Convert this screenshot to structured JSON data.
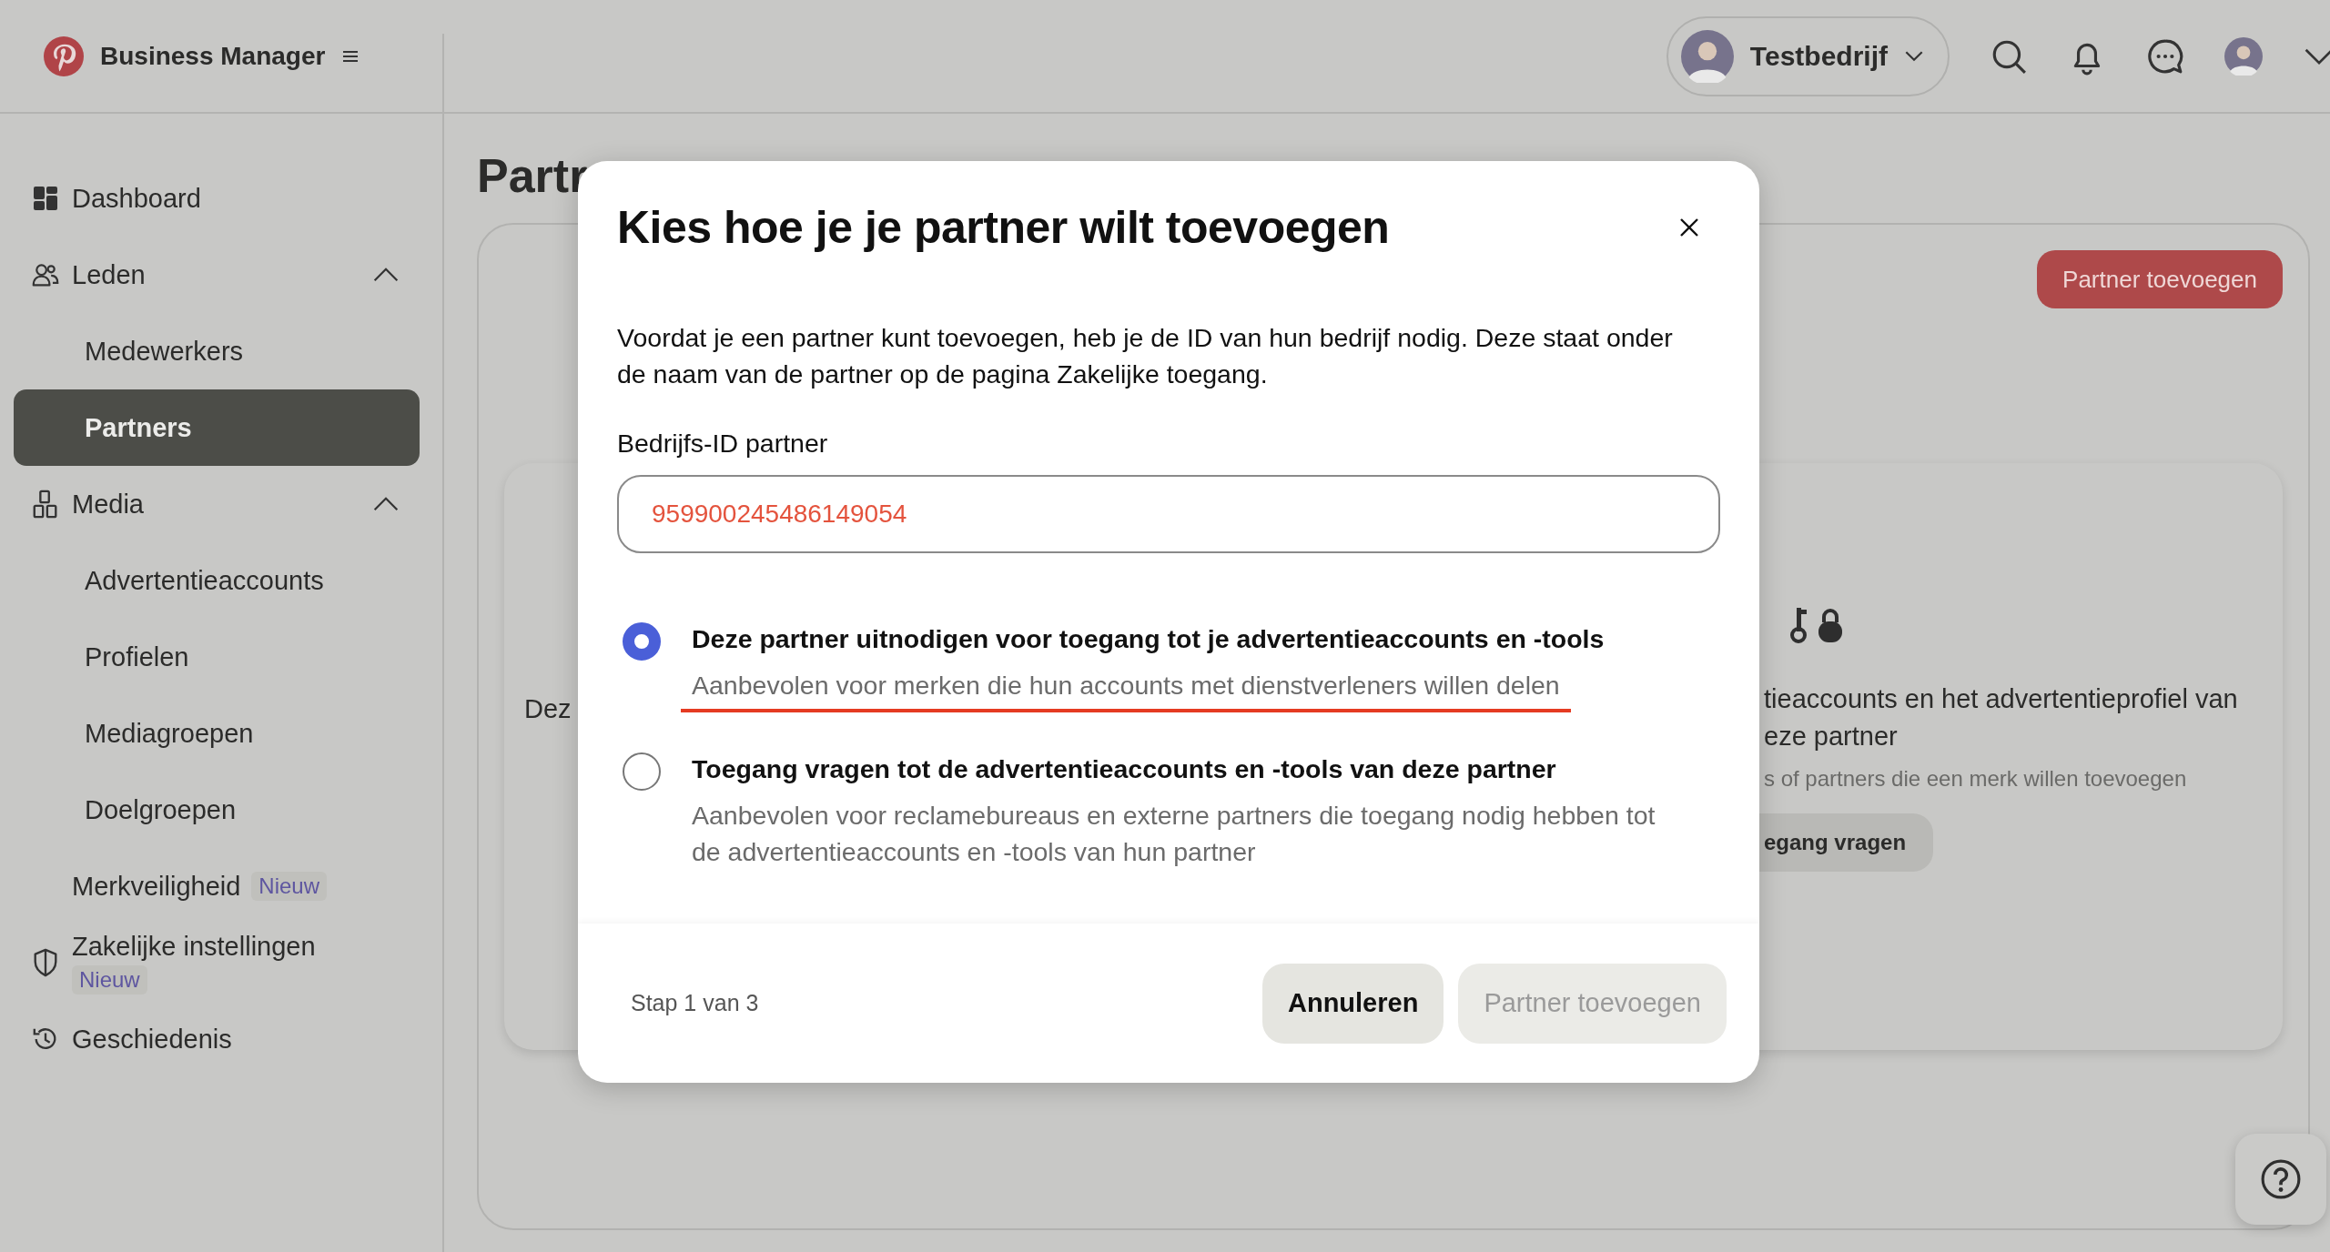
{
  "topbar": {
    "app_name": "Business Manager",
    "account": {
      "name": "Testbedrijf"
    }
  },
  "sidebar": {
    "items": [
      {
        "kind": "link",
        "label": "Dashboard",
        "selected": false
      },
      {
        "kind": "group",
        "label": "Leden",
        "expanded": true,
        "children": [
          {
            "label": "Medewerkers",
            "selected": false
          },
          {
            "label": "Partners",
            "selected": true
          }
        ]
      },
      {
        "kind": "group",
        "label": "Media",
        "expanded": true,
        "children": [
          {
            "label": "Advertentieaccounts",
            "selected": false
          },
          {
            "label": "Profielen",
            "selected": false
          },
          {
            "label": "Mediagroepen",
            "selected": false
          },
          {
            "label": "Doelgroepen",
            "selected": false
          }
        ]
      },
      {
        "kind": "link",
        "label": "Merkveiligheid",
        "badge": "Nieuw",
        "selected": false
      },
      {
        "kind": "link",
        "label": "Zakelijke instellingen",
        "badge": "Nieuw",
        "selected": false
      },
      {
        "kind": "link",
        "label": "Geschiedenis",
        "selected": false
      }
    ]
  },
  "page": {
    "title": "Partr",
    "header_button": "Partner toevoegen",
    "card": {
      "left_text": "Dez",
      "right_lines": [
        "tieaccounts en het advertentieprofiel van",
        "eze partner"
      ],
      "right_hint": "s of partners die een merk willen toevoegen",
      "right_button": "egang vragen"
    }
  },
  "modal": {
    "title": "Kies hoe je je partner wilt toevoegen",
    "intro": "Voordat je een partner kunt toevoegen, heb je de ID van hun bedrijf nodig. Deze staat onder de naam van de partner op de pagina Zakelijke toegang.",
    "field": {
      "label": "Bedrijfs-ID partner",
      "value": "959900245486149054"
    },
    "options": [
      {
        "title": "Deze partner uitnodigen voor toegang tot je advertentieaccounts en -tools",
        "description": "Aanbevolen voor merken die hun accounts met dienstverleners willen delen",
        "selected": true,
        "underlined": true
      },
      {
        "title": "Toegang vragen tot de advertentieaccounts en -tools van deze partner",
        "description": "Aanbevolen voor reclamebureaus en externe partners die toegang nodig hebben tot de advertentieaccounts en -tools van hun partner",
        "selected": false,
        "underlined": false
      }
    ],
    "step": "Stap 1 van 3",
    "buttons": [
      {
        "label": "Annuleren",
        "kind": "secondary",
        "disabled": false
      },
      {
        "label": "Partner toevoegen",
        "kind": "primary",
        "disabled": true
      }
    ]
  }
}
